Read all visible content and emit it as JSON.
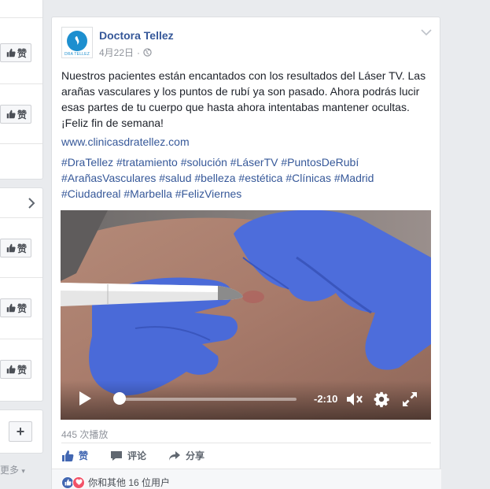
{
  "left_column": {
    "like_label": "赞",
    "plus_label": "+",
    "more_label": "更多",
    "more_caret": "▾"
  },
  "post": {
    "author": "Doctora Tellez",
    "avatar_brand": "DRA TELLEZ",
    "date": "4月22日",
    "date_sep": "·",
    "body": "Nuestros pacientes están encantados con los resultados del Láser TV. Las arañas vasculares y los puntos de rubí ya son pasado. Ahora podrás lucir esas partes de tu cuerpo que hasta ahora intentabas mantener ocultas. ¡Feliz fin de semana!",
    "link": "www.clinicasdratellez.com",
    "hashtags": "#DraTellez #tratamiento #solución #LáserTV #PuntosDeRubí #ArañasVasculares #salud #belleza #estética #Clínicas #Madrid #Ciudadreal #Marbella #FelizViernes",
    "video": {
      "time_remaining": "-2:10",
      "progress": 0.03
    },
    "views": "445 次播放",
    "actions": {
      "like": "赞",
      "comment": "评论",
      "share": "分享"
    },
    "reactions_text": "你和其他 16 位用户"
  },
  "colors": {
    "link": "#365899",
    "accent": "#4267b2",
    "love": "#f25268",
    "glove": "#4a6ad8"
  },
  "icons": [
    "thumbs-up-icon",
    "chevron-right-icon",
    "plus-icon",
    "globe-icon",
    "chevron-down-icon",
    "play-icon",
    "mute-icon",
    "gear-icon",
    "fullscreen-icon",
    "comment-icon",
    "share-icon",
    "heart-icon"
  ]
}
